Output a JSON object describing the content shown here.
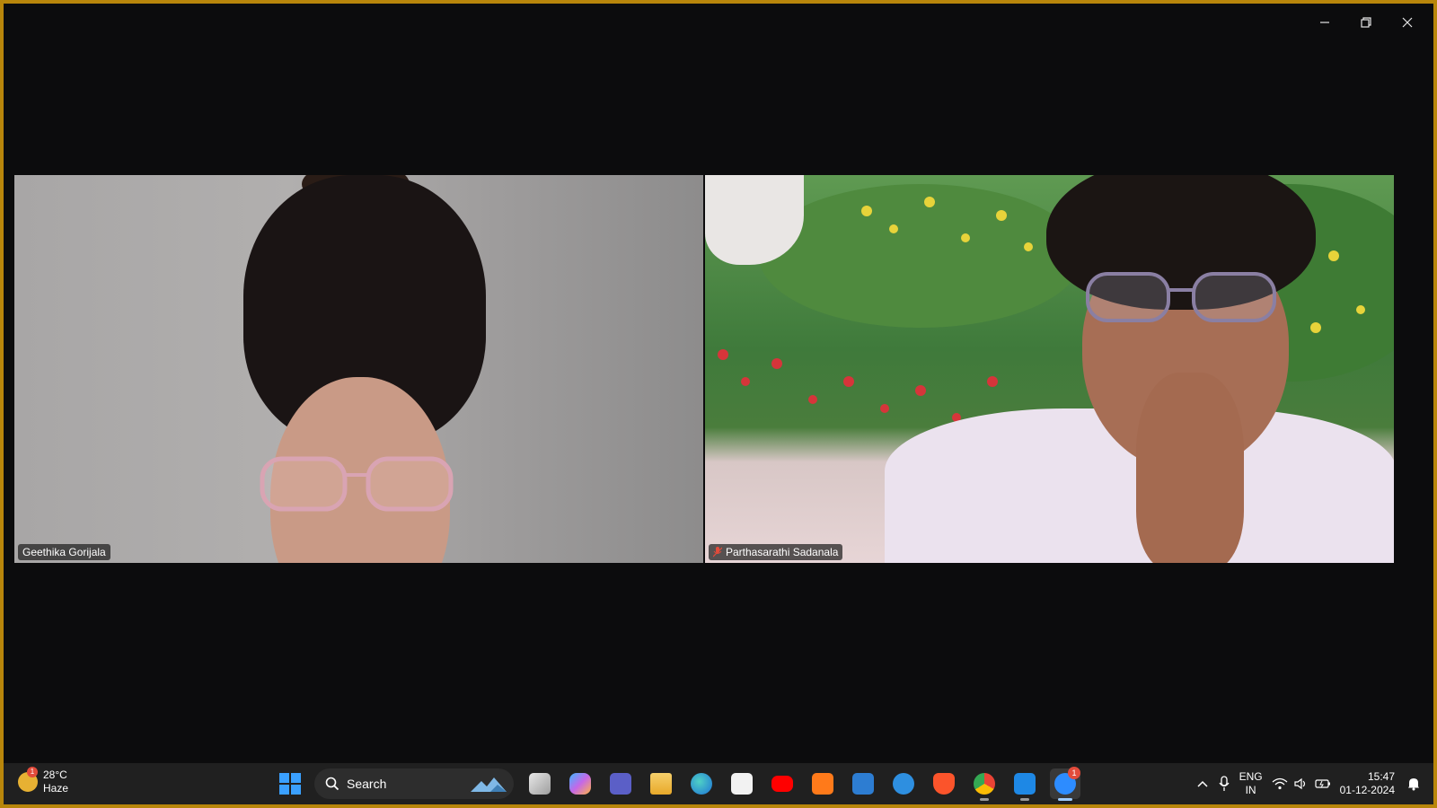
{
  "window": {
    "controls": {
      "minimize": "minimize",
      "restore": "restore",
      "close": "close"
    }
  },
  "participants": [
    {
      "name": "Geethika Gorijala",
      "muted": false
    },
    {
      "name": "Parthasarathi Sadanala",
      "muted": true
    }
  ],
  "taskbar": {
    "weather": {
      "temp": "28°C",
      "condition": "Haze",
      "badge": "1"
    },
    "search_label": "Search",
    "apps": [
      {
        "name": "task-view",
        "color": "#cfcfcf"
      },
      {
        "name": "copilot",
        "color": "#6e7cf1"
      },
      {
        "name": "teams",
        "color": "#5b5fc7"
      },
      {
        "name": "file-explorer",
        "color": "#f2c94c"
      },
      {
        "name": "edge",
        "color": "#1e90d6"
      },
      {
        "name": "microsoft-store",
        "color": "#f2f2f2"
      },
      {
        "name": "youtube",
        "color": "#ff0000"
      },
      {
        "name": "app-f",
        "color": "#ff7a1a"
      },
      {
        "name": "myjio",
        "color": "#2d7dd2"
      },
      {
        "name": "help",
        "color": "#2e8fe0"
      },
      {
        "name": "brave",
        "color": "#fb542b"
      },
      {
        "name": "chrome",
        "color": "#34a853"
      },
      {
        "name": "remote-desktop",
        "color": "#1e88e5"
      },
      {
        "name": "zoom",
        "color": "#2d8cff",
        "badge": "1"
      }
    ],
    "tray": {
      "lang_top": "ENG",
      "lang_bottom": "IN",
      "time": "15:47",
      "date": "01-12-2024"
    }
  }
}
